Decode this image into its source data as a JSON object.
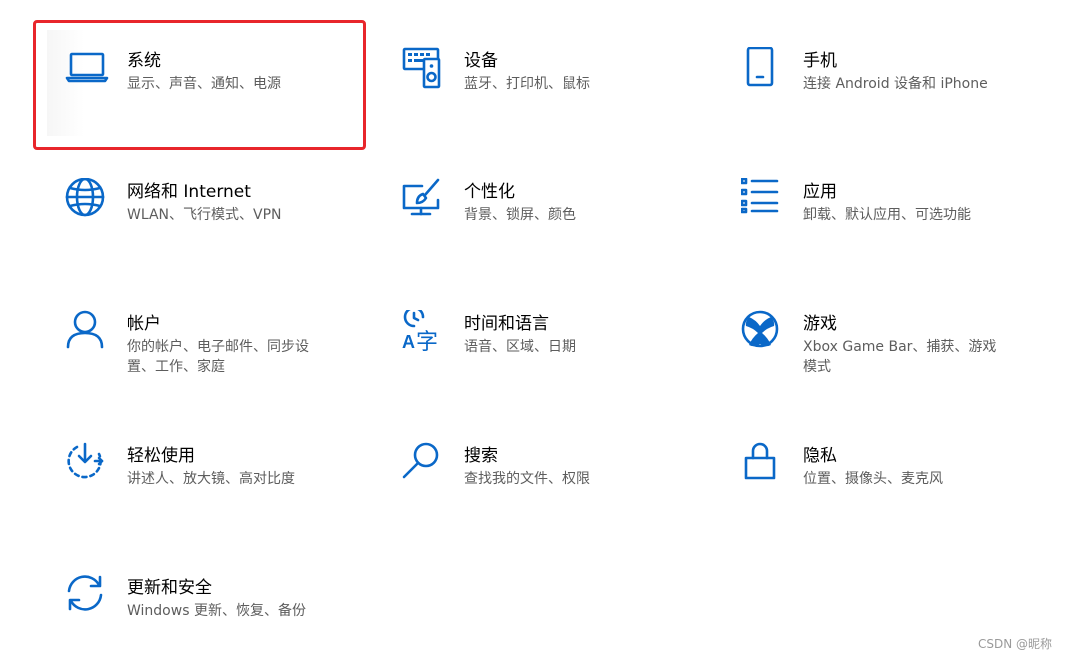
{
  "accent_color": "#0a68c8",
  "highlight_color": "#e8262b",
  "tiles": [
    {
      "title": "系统",
      "desc": "显示、声音、通知、电源",
      "icon": "laptop-icon"
    },
    {
      "title": "设备",
      "desc": "蓝牙、打印机、鼠标",
      "icon": "devices-icon"
    },
    {
      "title": "手机",
      "desc": "连接 Android 设备和 iPhone",
      "icon": "phone-icon"
    },
    {
      "title": "网络和 Internet",
      "desc": "WLAN、飞行模式、VPN",
      "icon": "globe-icon"
    },
    {
      "title": "个性化",
      "desc": "背景、锁屏、颜色",
      "icon": "personalization-icon"
    },
    {
      "title": "应用",
      "desc": "卸载、默认应用、可选功能",
      "icon": "apps-list-icon"
    },
    {
      "title": "帐户",
      "desc": "你的帐户、电子邮件、同步设置、工作、家庭",
      "icon": "person-icon"
    },
    {
      "title": "时间和语言",
      "desc": "语音、区域、日期",
      "icon": "time-language-icon"
    },
    {
      "title": "游戏",
      "desc": "Xbox Game Bar、捕获、游戏模式",
      "icon": "xbox-icon"
    },
    {
      "title": "轻松使用",
      "desc": "讲述人、放大镜、高对比度",
      "icon": "ease-of-access-icon"
    },
    {
      "title": "搜索",
      "desc": "查找我的文件、权限",
      "icon": "search-icon"
    },
    {
      "title": "隐私",
      "desc": "位置、摄像头、麦克风",
      "icon": "lock-icon"
    },
    {
      "title": "更新和安全",
      "desc": "Windows 更新、恢复、备份",
      "icon": "sync-icon"
    }
  ],
  "watermark": "CSDN @昵称"
}
